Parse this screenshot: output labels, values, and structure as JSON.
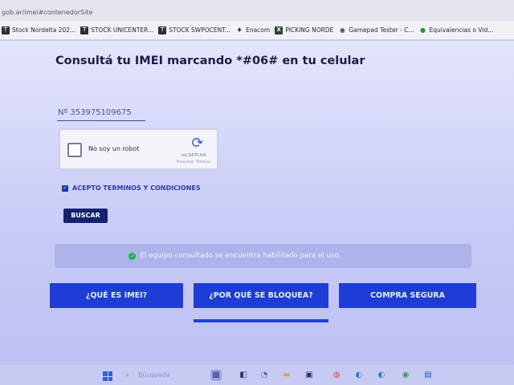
{
  "browser": {
    "address": "gob.ar/imei#contenedorSite",
    "bookmarks": [
      {
        "icon": "document-icon",
        "label": "Stock Nordelta 202..."
      },
      {
        "icon": "document-icon",
        "label": "STOCK UNICENTER..."
      },
      {
        "icon": "document-icon",
        "label": "STOCK SWPOCENT..."
      },
      {
        "icon": "flame-icon",
        "label": "Enacom"
      },
      {
        "icon": "spreadsheet-icon",
        "label": "PICKING NORDE"
      },
      {
        "icon": "gamepad-icon",
        "label": "Gamepad Tester - C..."
      },
      {
        "icon": "globe-icon",
        "label": "Equivalencias o Vid..."
      }
    ]
  },
  "page": {
    "title": "Consultá tu IMEI marcando *#06# en tu celular",
    "imei_value": "Nº 353975109675",
    "captcha": {
      "label": "No soy un robot",
      "brand": "reCAPTCHA",
      "links": "Privacidad - Términos"
    },
    "terms_label": "ACEPTO TERMINOS Y CONDICIONES",
    "search_button": "BUSCAR",
    "result_message": "El equipo consultado se encuentra habilitado para el uso.",
    "cta_buttons": [
      "¿QUÉ ES IMEI?",
      "¿POR QUÉ SE BLOQUEA?",
      "COMPRA SEGURA"
    ]
  },
  "taskbar": {
    "search_text": "Búsqueda"
  },
  "colors": {
    "primary_button": "#1d3dd6",
    "search_button": "#14236f",
    "success": "#23b04a"
  }
}
